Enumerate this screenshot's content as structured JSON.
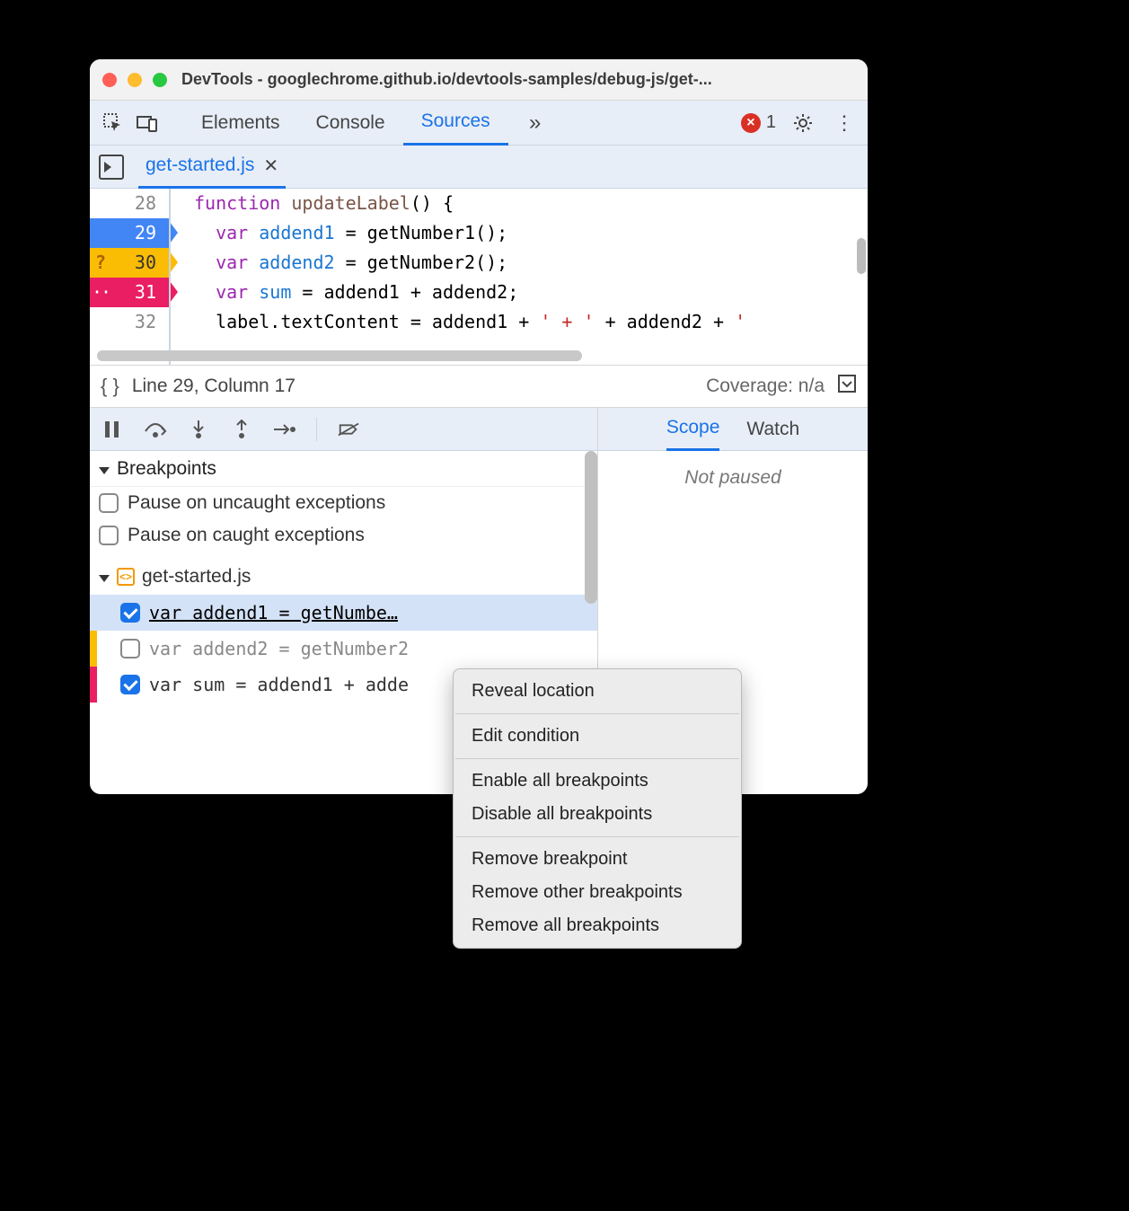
{
  "window": {
    "title": "DevTools - googlechrome.github.io/devtools-samples/debug-js/get-..."
  },
  "toolbar": {
    "tabs": [
      "Elements",
      "Console",
      "Sources"
    ],
    "active_tab": "Sources",
    "error_count": "1"
  },
  "file_tab": {
    "name": "get-started.js"
  },
  "code": {
    "lines": [
      {
        "n": "28",
        "bp": "",
        "html": "<span class='kw'>function</span> <span class='fn'>updateLabel</span>() {"
      },
      {
        "n": "29",
        "bp": "blue",
        "html": "  <span class='kw'>var</span> <span class='var'>addend1</span> = getNumber1();"
      },
      {
        "n": "30",
        "bp": "orange",
        "html": "  <span class='kw'>var</span> <span class='var'>addend2</span> = getNumber2();"
      },
      {
        "n": "31",
        "bp": "pink",
        "html": "  <span class='kw'>var</span> <span class='var'>sum</span> = addend1 + addend2;"
      },
      {
        "n": "32",
        "bp": "",
        "html": "  label.textContent = addend1 + <span class='str'>' + '</span> + addend2 + <span class='str'>'</span>"
      }
    ]
  },
  "statusbar": {
    "cursor": "Line 29, Column 17",
    "coverage": "Coverage: n/a"
  },
  "breakpoints": {
    "header": "Breakpoints",
    "uncaught": "Pause on uncaught exceptions",
    "caught": "Pause on caught exceptions",
    "file": "get-started.js",
    "entries": [
      {
        "text": "var addend1 = getNumbe…",
        "checked": true,
        "selected": true,
        "edge": ""
      },
      {
        "text": "var addend2 = getNumber2",
        "checked": false,
        "selected": false,
        "edge": "orange"
      },
      {
        "text": "var sum = addend1 + adde",
        "checked": true,
        "selected": false,
        "edge": "pink"
      }
    ]
  },
  "scope_watch": {
    "tabs": [
      "Scope",
      "Watch"
    ],
    "active": "Scope",
    "message": "Not paused"
  },
  "context_menu": {
    "items": [
      "Reveal location",
      "-",
      "Edit condition",
      "-",
      "Enable all breakpoints",
      "Disable all breakpoints",
      "-",
      "Remove breakpoint",
      "Remove other breakpoints",
      "Remove all breakpoints"
    ]
  }
}
